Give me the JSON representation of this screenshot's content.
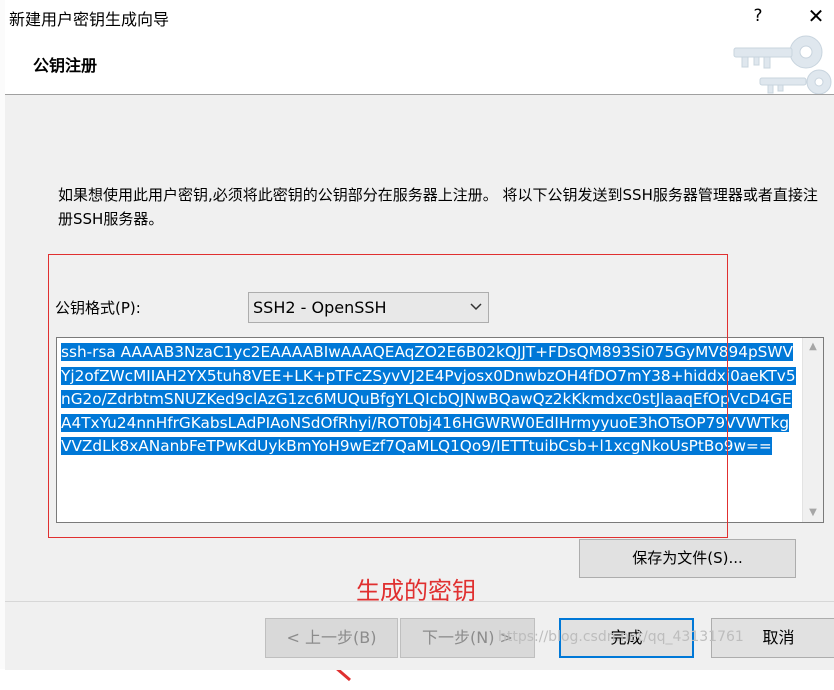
{
  "window": {
    "title": "新建用户密钥生成向导",
    "help_symbol": "?",
    "close_symbol": "✕"
  },
  "header": {
    "title": "公钥注册",
    "graphic_icon": "keys-icon"
  },
  "body": {
    "instruction": "如果想使用此用户密钥,必须将此密钥的公钥部分在服务器上注册。 将以下公钥发送到SSH服务器管理器或者直接注册SSH服务器。",
    "format_label": "公钥格式(P):",
    "format_value": "SSH2 - OpenSSH",
    "public_key": "ssh-rsa AAAAB3NzaC1yc2EAAAABIwAAAQEAqZO2E6B02kQJJT+FDsQM893Si075GyMV894pSWVYj2ofZWcMIIAH2YX5tuh8VEE+LK+pTFcZSyvVJ2E4Pvjosx0DnwbzOH4fDO7mY38+hiddxi0aeKTv5nG2o/ZdrbtmSNUZKed9clAzG1zc6MUQuBfgYLQIcbQJNwBQawQz2kKkmdxc0stJlaaqEfOpVcD4GEA4TxYu24nnHfrGKabsLAdPIAoNSdOfRhyi/ROT0bj416HGWRW0EdIHrmyyuoE3hOTsOP79VVWTkgVVZdLk8xANanbFeTPwKdUykBmYoH9wEzf7QaMLQ1Qo9/IETTtuibCsb+l1xcgNkoUsPtBo9w==",
    "save_button": "保存为文件(S)...",
    "annotation_text": "生成的密钥"
  },
  "footer": {
    "back_button": "< 上一步(B)",
    "next_button": "下一步(N) >",
    "finish_button": "完成",
    "cancel_button": "取消",
    "watermark": "https://blog.csdn.net/qq_43131761"
  },
  "colors": {
    "selection": "#0078d7",
    "annotation": "#e03030"
  }
}
